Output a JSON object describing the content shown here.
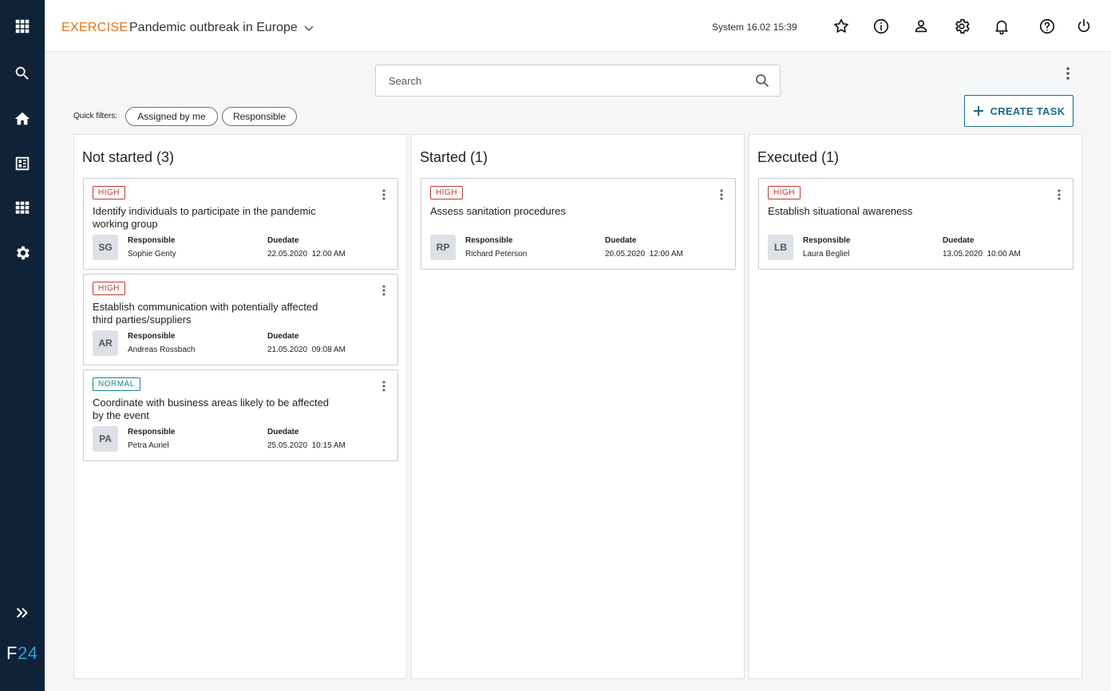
{
  "header": {
    "mode": "EXERCISE",
    "title": "Pandemic outbreak in Europe",
    "clock": "System 16.02 15:39"
  },
  "sidebar": {
    "logo_letter": "F",
    "logo_number": "24"
  },
  "search": {
    "placeholder": "Search"
  },
  "quick_filters": {
    "label": "Quick filters:",
    "chips": [
      "Assigned by me",
      "Responsible"
    ]
  },
  "create_task_label": "CREATE TASK",
  "columns": [
    {
      "title": "Not started (3)",
      "cards": [
        {
          "priority": "HIGH",
          "title": "Identify individuals to participate in the pandemic working group",
          "initials": "SG",
          "responsible_label": "Responsible",
          "responsible": "Sophie Genty",
          "due_label": "Duedate",
          "due": "22.05.2020  12:00 AM"
        },
        {
          "priority": "HIGH",
          "title": "Establish communication with potentially affected third parties/suppliers",
          "initials": "AR",
          "responsible_label": "Responsible",
          "responsible": "Andreas Rossbach",
          "due_label": "Duedate",
          "due": "21.05.2020  09:08 AM"
        },
        {
          "priority": "NORMAL",
          "title": "Coordinate with business areas likely to be affected by the event",
          "initials": "PA",
          "responsible_label": "Responsible",
          "responsible": "Petra Auriel",
          "due_label": "Duedate",
          "due": "25.05.2020  10:15 AM"
        }
      ]
    },
    {
      "title": "Started (1)",
      "cards": [
        {
          "priority": "HIGH",
          "title": "Assess sanitation procedures",
          "initials": "RP",
          "responsible_label": "Responsible",
          "responsible": "Richard Peterson",
          "due_label": "Duedate",
          "due": "20.05.2020  12:00 AM"
        }
      ]
    },
    {
      "title": "Executed (1)",
      "cards": [
        {
          "priority": "HIGH",
          "title": "Establish situational awareness",
          "initials": "LB",
          "responsible_label": "Responsible",
          "responsible": "Laura Begliel",
          "due_label": "Duedate",
          "due": "13.05.2020  10:00 AM"
        }
      ]
    }
  ],
  "icons": {
    "sidebar": [
      "apps-grid-icon",
      "search-icon",
      "home-icon",
      "dashboard-icon",
      "modules-icon",
      "settings-icon",
      "expand-icon"
    ],
    "header": [
      "star-icon",
      "info-icon",
      "user-icon",
      "gear-icon",
      "bell-icon",
      "help-icon",
      "power-icon",
      "chevron-down-icon"
    ]
  },
  "colors": {
    "sidebar_bg": "#0f2237",
    "mode_accent": "#e2731a",
    "primary": "#1a6a8a",
    "high_priority": "#c0392b",
    "normal_priority": "#16858f",
    "logo_accent": "#2f9fe0"
  }
}
